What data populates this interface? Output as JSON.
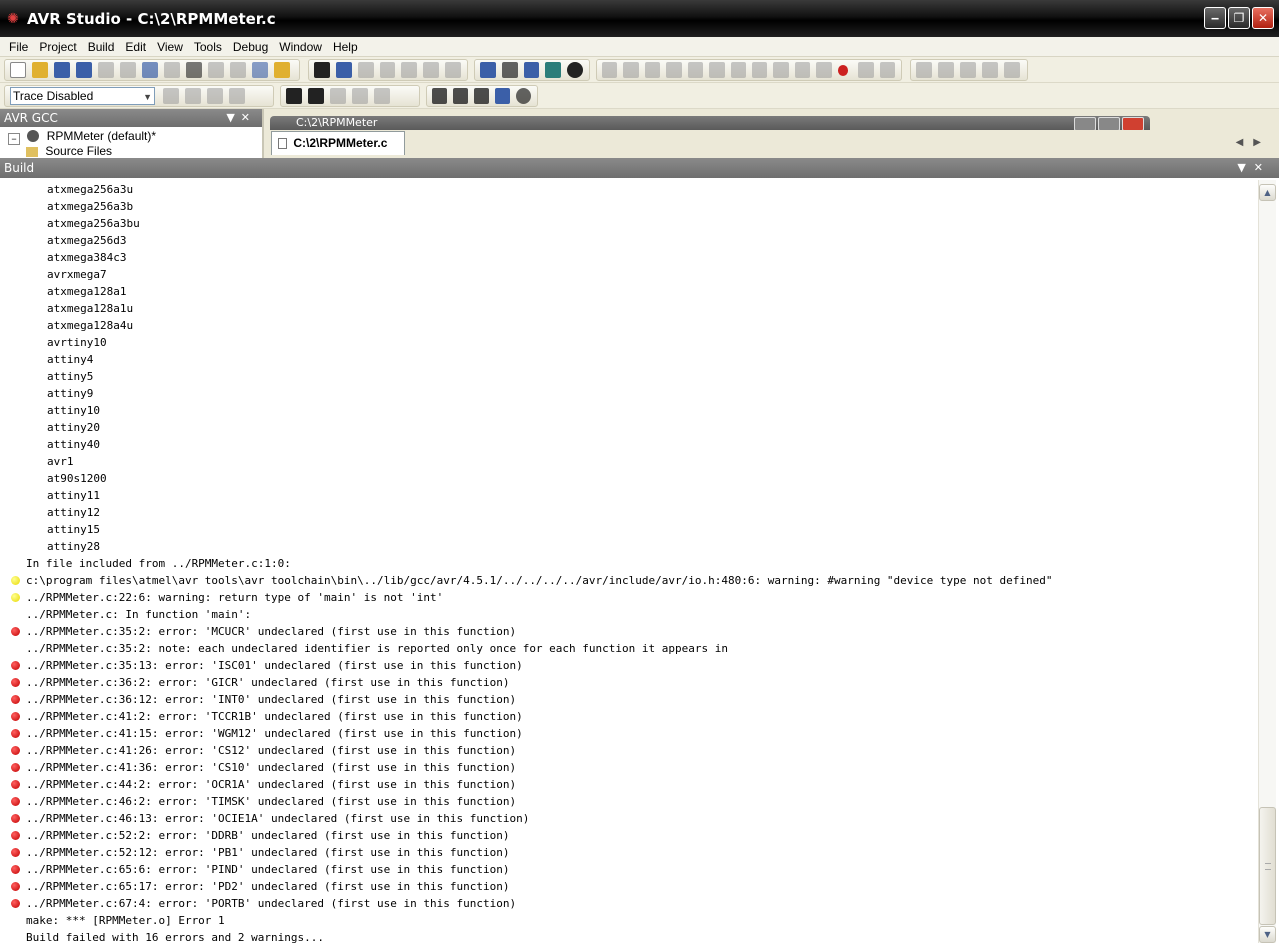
{
  "window": {
    "title": "AVR Studio - C:\\2\\RPMMeter.c"
  },
  "menu": [
    "File",
    "Project",
    "Build",
    "Edit",
    "View",
    "Tools",
    "Debug",
    "Window",
    "Help"
  ],
  "toolbar2": {
    "trace_select": "Trace Disabled"
  },
  "avr_gcc_panel": {
    "title": "AVR GCC",
    "project": "RPMMeter (default)*",
    "folder": "Source Files"
  },
  "document": {
    "inner_title": "C:\\2\\RPMMeter",
    "tab_label": "C:\\2\\RPMMeter.c"
  },
  "build_panel": {
    "title": "Build",
    "lines": [
      {
        "text": "atxmega256a3u",
        "kind": "device"
      },
      {
        "text": "atxmega256a3b",
        "kind": "device"
      },
      {
        "text": "atxmega256a3bu",
        "kind": "device"
      },
      {
        "text": "atxmega256d3",
        "kind": "device"
      },
      {
        "text": "atxmega384c3",
        "kind": "device"
      },
      {
        "text": "avrxmega7",
        "kind": "device"
      },
      {
        "text": "atxmega128a1",
        "kind": "device"
      },
      {
        "text": "atxmega128a1u",
        "kind": "device"
      },
      {
        "text": "atxmega128a4u",
        "kind": "device"
      },
      {
        "text": "avrtiny10",
        "kind": "device"
      },
      {
        "text": "attiny4",
        "kind": "device"
      },
      {
        "text": "attiny5",
        "kind": "device"
      },
      {
        "text": "attiny9",
        "kind": "device"
      },
      {
        "text": "attiny10",
        "kind": "device"
      },
      {
        "text": "attiny20",
        "kind": "device"
      },
      {
        "text": "attiny40",
        "kind": "device"
      },
      {
        "text": "avr1",
        "kind": "device"
      },
      {
        "text": "at90s1200",
        "kind": "device"
      },
      {
        "text": "attiny11",
        "kind": "device"
      },
      {
        "text": "attiny12",
        "kind": "device"
      },
      {
        "text": "attiny15",
        "kind": "device"
      },
      {
        "text": "attiny28",
        "kind": "device"
      },
      {
        "text": "In file included from ../RPMMeter.c:1:0:",
        "kind": "info"
      },
      {
        "text": "c:\\program files\\atmel\\avr tools\\avr toolchain\\bin\\../lib/gcc/avr/4.5.1/../../../../avr/include/avr/io.h:480:6: warning: #warning \"device type not defined\"",
        "kind": "warning"
      },
      {
        "text": "../RPMMeter.c:22:6: warning: return type of 'main' is not 'int'",
        "kind": "warning"
      },
      {
        "text": "../RPMMeter.c: In function 'main':",
        "kind": "info"
      },
      {
        "text": "../RPMMeter.c:35:2: error: 'MCUCR' undeclared (first use in this function)",
        "kind": "error"
      },
      {
        "text": "../RPMMeter.c:35:2: note: each undeclared identifier is reported only once for each function it appears in",
        "kind": "info"
      },
      {
        "text": "../RPMMeter.c:35:13: error: 'ISC01' undeclared (first use in this function)",
        "kind": "error"
      },
      {
        "text": "../RPMMeter.c:36:2: error: 'GICR' undeclared (first use in this function)",
        "kind": "error"
      },
      {
        "text": "../RPMMeter.c:36:12: error: 'INT0' undeclared (first use in this function)",
        "kind": "error"
      },
      {
        "text": "../RPMMeter.c:41:2: error: 'TCCR1B' undeclared (first use in this function)",
        "kind": "error"
      },
      {
        "text": "../RPMMeter.c:41:15: error: 'WGM12' undeclared (first use in this function)",
        "kind": "error"
      },
      {
        "text": "../RPMMeter.c:41:26: error: 'CS12' undeclared (first use in this function)",
        "kind": "error"
      },
      {
        "text": "../RPMMeter.c:41:36: error: 'CS10' undeclared (first use in this function)",
        "kind": "error"
      },
      {
        "text": "../RPMMeter.c:44:2: error: 'OCR1A' undeclared (first use in this function)",
        "kind": "error"
      },
      {
        "text": "../RPMMeter.c:46:2: error: 'TIMSK' undeclared (first use in this function)",
        "kind": "error"
      },
      {
        "text": "../RPMMeter.c:46:13: error: 'OCIE1A' undeclared (first use in this function)",
        "kind": "error"
      },
      {
        "text": "../RPMMeter.c:52:2: error: 'DDRB' undeclared (first use in this function)",
        "kind": "error"
      },
      {
        "text": "../RPMMeter.c:52:12: error: 'PB1' undeclared (first use in this function)",
        "kind": "error"
      },
      {
        "text": "../RPMMeter.c:65:6: error: 'PIND' undeclared (first use in this function)",
        "kind": "error"
      },
      {
        "text": "../RPMMeter.c:65:17: error: 'PD2' undeclared (first use in this function)",
        "kind": "error"
      },
      {
        "text": "../RPMMeter.c:67:4: error: 'PORTB' undeclared (first use in this function)",
        "kind": "error"
      },
      {
        "text": "make: *** [RPMMeter.o] Error 1",
        "kind": "info"
      },
      {
        "text": "Build failed with 16 errors and 2 warnings...",
        "kind": "info"
      }
    ]
  },
  "colors": {
    "error": "#cc0000",
    "warning": "#e8d800",
    "panel_header": "#7a7a7a"
  }
}
